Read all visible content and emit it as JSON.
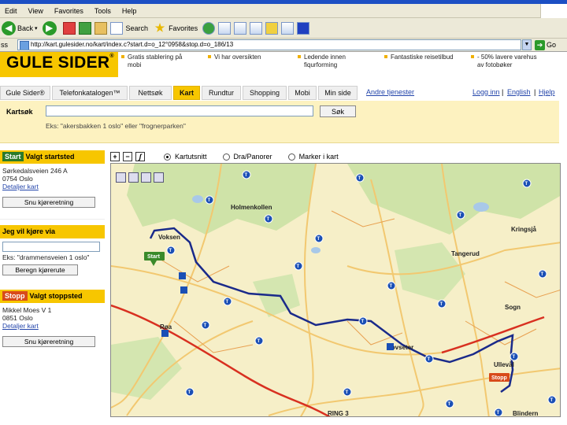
{
  "browser": {
    "menu": [
      "Edit",
      "View",
      "Favorites",
      "Tools",
      "Help"
    ],
    "toolbar": {
      "back": "Back",
      "search": "Search",
      "favorites": "Favorites",
      "go": "Go"
    },
    "address": {
      "label": "ss",
      "url": "http://kart.gulesider.no/kart/index.c?start.d=o_12°0958&stop.d=o_186/13"
    }
  },
  "header": {
    "logo": "GULE SIDER",
    "logo_mark": "®",
    "promos": [
      "Gratis stablering på\nmobi",
      "Vi har oversikten",
      "Ledende innen\nfiqurforming",
      "Fantastiske reisetilbud",
      "- 50% lavere varehus\nav fotobøker"
    ]
  },
  "nav": {
    "tabs": [
      "Gule Sider®",
      "Telefonkatalogen™",
      "Nettsøk",
      "Kart",
      "Rundtur",
      "Shopping",
      "Mobi",
      "Min side"
    ],
    "active_tab": "Kart",
    "other_services": "Andre tjenester",
    "login": "Logg inn",
    "english": "English",
    "help": "Hjelp",
    "separator": "|"
  },
  "search": {
    "label": "Kartsøk",
    "value": "",
    "button": "Søk",
    "example": "Eks: \"akersbakken 1 oslo\" eller \"frognerparken\""
  },
  "start_panel": {
    "badge": "Start",
    "title": "Valgt startsted",
    "address_line1": "Sørkedalsveien 246 A",
    "address_line2": "0754 Oslo",
    "details_link": "Detaljer kart",
    "reverse_button": "Snu kjøreretning"
  },
  "via_panel": {
    "title": "Jeg vil kjøre via",
    "example": "Eks: \"drammensveien 1 oslo\"",
    "button": "Beregn kjørerute"
  },
  "stop_panel": {
    "badge": "Stopp",
    "title": "Valgt stoppsted",
    "address_line1": "Mikkel Moes V 1",
    "address_line2": "0851 Oslo",
    "details_link": "Detaljer kart",
    "reverse_button": "Snu kjøreretning"
  },
  "map_tools": {
    "zoom_in": "+",
    "zoom_out": "−",
    "hand": "ʃ",
    "options": [
      "Kartutsnitt",
      "Dra/Panorer",
      "Marker i kart"
    ],
    "selected": "Kartutsnitt"
  },
  "map": {
    "places": [
      "Holmenkollen",
      "Tangerud",
      "Kringsjå",
      "Sogn",
      "Ullevål",
      "Blindern",
      "Røa",
      "Hovseter",
      "Voksen"
    ],
    "start_pin": "Start",
    "stop_pin": "Stopp",
    "station_glyph": "T",
    "ring_label": "RING 3",
    "route_color": "#1a2a8a"
  }
}
